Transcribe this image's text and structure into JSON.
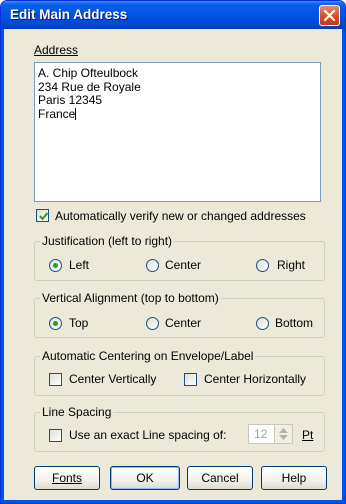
{
  "window": {
    "title": "Edit Main Address"
  },
  "address": {
    "label": "Address",
    "lines": [
      "A. Chip Ofteulbock",
      "234 Rue de Royale",
      "Paris 12345",
      "France"
    ]
  },
  "verify": {
    "checked": true,
    "label": "Automatically verify new or changed addresses"
  },
  "justification": {
    "legend": "Justification (left to right)",
    "options": [
      "Left",
      "Center",
      "Right"
    ],
    "selected": "Left"
  },
  "vertical": {
    "legend": "Vertical Alignment (top to bottom)",
    "options": [
      "Top",
      "Center",
      "Bottom"
    ],
    "selected": "Top"
  },
  "centering": {
    "legend": "Automatic Centering on Envelope/Label",
    "vertical_label": "Center Vertically",
    "horizontal_label": "Center Horizontally"
  },
  "spacing": {
    "legend": "Line Spacing",
    "label": "Use an exact Line spacing of:",
    "value": "12",
    "unit": "Pt"
  },
  "buttons": {
    "fonts": "Fonts",
    "ok": "OK",
    "cancel": "Cancel",
    "help": "Help"
  }
}
